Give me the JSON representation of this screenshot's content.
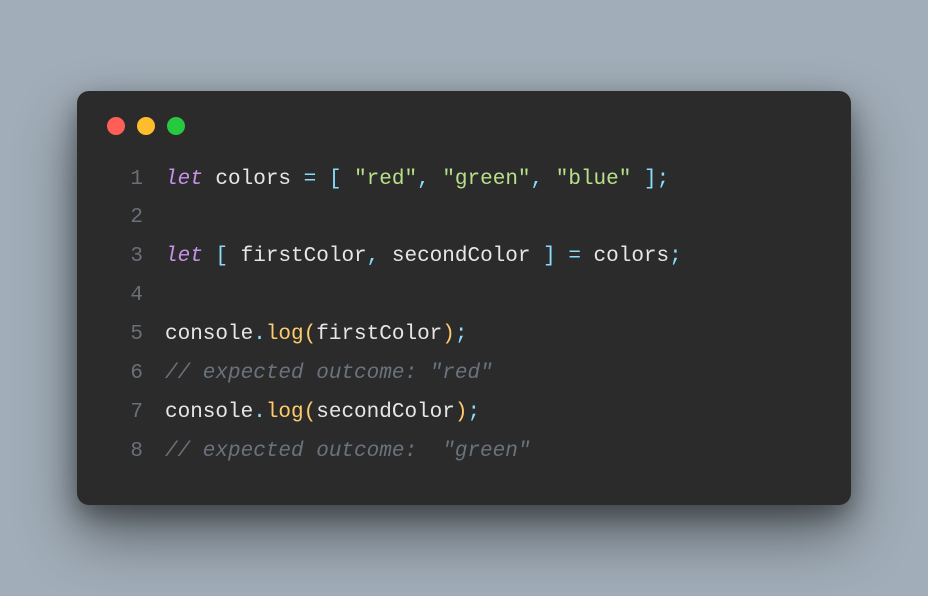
{
  "window": {
    "dots": [
      "red",
      "yellow",
      "green"
    ]
  },
  "code": {
    "lines": [
      {
        "n": "1",
        "segs": [
          {
            "c": "tok-kw",
            "t": "let"
          },
          {
            "c": "tok-id",
            "t": " colors "
          },
          {
            "c": "tok-punc",
            "t": "="
          },
          {
            "c": "tok-id",
            "t": " "
          },
          {
            "c": "tok-punc",
            "t": "["
          },
          {
            "c": "tok-id",
            "t": " "
          },
          {
            "c": "tok-str",
            "t": "\"red\""
          },
          {
            "c": "tok-punc",
            "t": ","
          },
          {
            "c": "tok-id",
            "t": " "
          },
          {
            "c": "tok-str",
            "t": "\"green\""
          },
          {
            "c": "tok-punc",
            "t": ","
          },
          {
            "c": "tok-id",
            "t": " "
          },
          {
            "c": "tok-str",
            "t": "\"blue\""
          },
          {
            "c": "tok-id",
            "t": " "
          },
          {
            "c": "tok-punc",
            "t": "];"
          }
        ]
      },
      {
        "n": "2",
        "segs": [
          {
            "c": "tok-id",
            "t": ""
          }
        ]
      },
      {
        "n": "3",
        "segs": [
          {
            "c": "tok-kw",
            "t": "let"
          },
          {
            "c": "tok-id",
            "t": " "
          },
          {
            "c": "tok-punc",
            "t": "["
          },
          {
            "c": "tok-id",
            "t": " firstColor"
          },
          {
            "c": "tok-punc",
            "t": ","
          },
          {
            "c": "tok-id",
            "t": " secondColor "
          },
          {
            "c": "tok-punc",
            "t": "]"
          },
          {
            "c": "tok-id",
            "t": " "
          },
          {
            "c": "tok-punc",
            "t": "="
          },
          {
            "c": "tok-id",
            "t": " colors"
          },
          {
            "c": "tok-punc",
            "t": ";"
          }
        ]
      },
      {
        "n": "4",
        "segs": [
          {
            "c": "tok-id",
            "t": ""
          }
        ]
      },
      {
        "n": "5",
        "segs": [
          {
            "c": "tok-obj",
            "t": "console"
          },
          {
            "c": "tok-dot",
            "t": "."
          },
          {
            "c": "tok-fn",
            "t": "log"
          },
          {
            "c": "tok-paren",
            "t": "("
          },
          {
            "c": "tok-id",
            "t": "firstColor"
          },
          {
            "c": "tok-paren",
            "t": ")"
          },
          {
            "c": "tok-punc",
            "t": ";"
          }
        ]
      },
      {
        "n": "6",
        "segs": [
          {
            "c": "tok-comment",
            "t": "// expected outcome: \"red\""
          }
        ]
      },
      {
        "n": "7",
        "segs": [
          {
            "c": "tok-obj",
            "t": "console"
          },
          {
            "c": "tok-dot",
            "t": "."
          },
          {
            "c": "tok-fn",
            "t": "log"
          },
          {
            "c": "tok-paren",
            "t": "("
          },
          {
            "c": "tok-id",
            "t": "secondColor"
          },
          {
            "c": "tok-paren",
            "t": ")"
          },
          {
            "c": "tok-punc",
            "t": ";"
          }
        ]
      },
      {
        "n": "8",
        "segs": [
          {
            "c": "tok-comment",
            "t": "// expected outcome:  \"green\""
          }
        ]
      }
    ]
  }
}
